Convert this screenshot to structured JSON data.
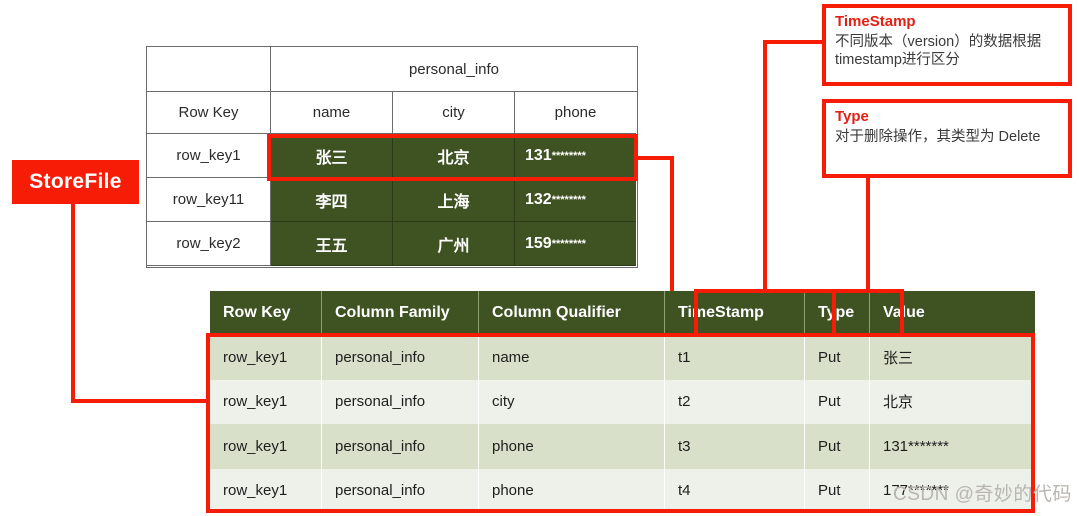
{
  "storefile": {
    "label": "StoreFile"
  },
  "logical_table": {
    "column_family_title": "personal_info",
    "headers": [
      "Row Key",
      "name",
      "city",
      "phone"
    ],
    "rows": [
      {
        "row_key": "row_key1",
        "name": "张三",
        "city": "北京",
        "phone_prefix": "131",
        "phone_stars": "********"
      },
      {
        "row_key": "row_key11",
        "name": "李四",
        "city": "上海",
        "phone_prefix": "132",
        "phone_stars": "********"
      },
      {
        "row_key": "row_key2",
        "name": "王五",
        "city": "广州",
        "phone_prefix": "159",
        "phone_stars": "********"
      }
    ]
  },
  "kv_table": {
    "headers": [
      "Row Key",
      "Column Family",
      "Column Qualifier",
      "TimeStamp",
      "Type",
      "Value"
    ],
    "rows": [
      {
        "row_key": "row_key1",
        "family": "personal_info",
        "qualifier": "name",
        "timestamp": "t1",
        "type": "Put",
        "value": "张三"
      },
      {
        "row_key": "row_key1",
        "family": "personal_info",
        "qualifier": "city",
        "timestamp": "t2",
        "type": "Put",
        "value": "北京"
      },
      {
        "row_key": "row_key1",
        "family": "personal_info",
        "qualifier": "phone",
        "timestamp": "t3",
        "type": "Put",
        "value": "131*******"
      },
      {
        "row_key": "row_key1",
        "family": "personal_info",
        "qualifier": "phone",
        "timestamp": "t4",
        "type": "Put",
        "value": "177*******"
      }
    ]
  },
  "callouts": {
    "timestamp": {
      "title": "TimeStamp",
      "body": "不同版本（version）的数据根据timestamp进行区分"
    },
    "type": {
      "title": "Type",
      "body": "对于删除操作，其类型为 Delete"
    }
  },
  "watermark": {
    "text": "CSDN @奇妙的代码"
  },
  "colors": {
    "accent_red": "#f71c06",
    "dark_green": "#3e5222",
    "row_odd": "#d8e0c9",
    "row_even": "#eef1e9",
    "callout_title": "#e32013"
  }
}
